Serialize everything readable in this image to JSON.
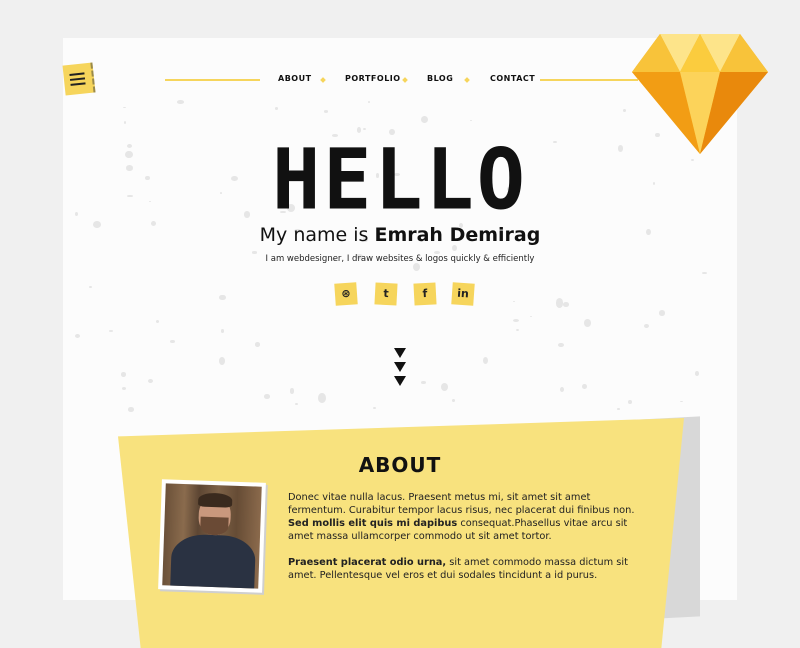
{
  "nav": {
    "items": [
      "ABOUT",
      "PORTFOLIO",
      "BLOG",
      "CONTACT"
    ]
  },
  "hero": {
    "hello": "HELLO",
    "intro_prefix": "My name is ",
    "intro_name": "Emrah Demirag",
    "tagline": "I am webdesigner, I draw websites & logos quickly & efficiently"
  },
  "social": [
    {
      "name": "dribbble-icon",
      "glyph": "⊛"
    },
    {
      "name": "twitter-icon",
      "glyph": "t"
    },
    {
      "name": "facebook-icon",
      "glyph": "f"
    },
    {
      "name": "linkedin-icon",
      "glyph": "in"
    }
  ],
  "about": {
    "title": "ABOUT",
    "p1_a": "Donec vitae nulla lacus. Praesent metus mi, sit amet sit amet fermentum. Curabitur tempor lacus risus, nec placerat dui finibus non. ",
    "p1_bold": "Sed mollis elit quis mi dapibus",
    "p1_b": " consequat.Phasellus vitae arcu sit amet massa ullamcorper commodo ut sit amet tortor.",
    "p2_bold": "Praesent placerat odio urna,",
    "p2_a": " sit amet commodo massa dictum sit amet. Pellentesque vel eros et dui sodales tincidunt a id purus."
  },
  "colors": {
    "accent": "#f6d55c",
    "about_bg": "#f8e27e",
    "text": "#111111"
  }
}
